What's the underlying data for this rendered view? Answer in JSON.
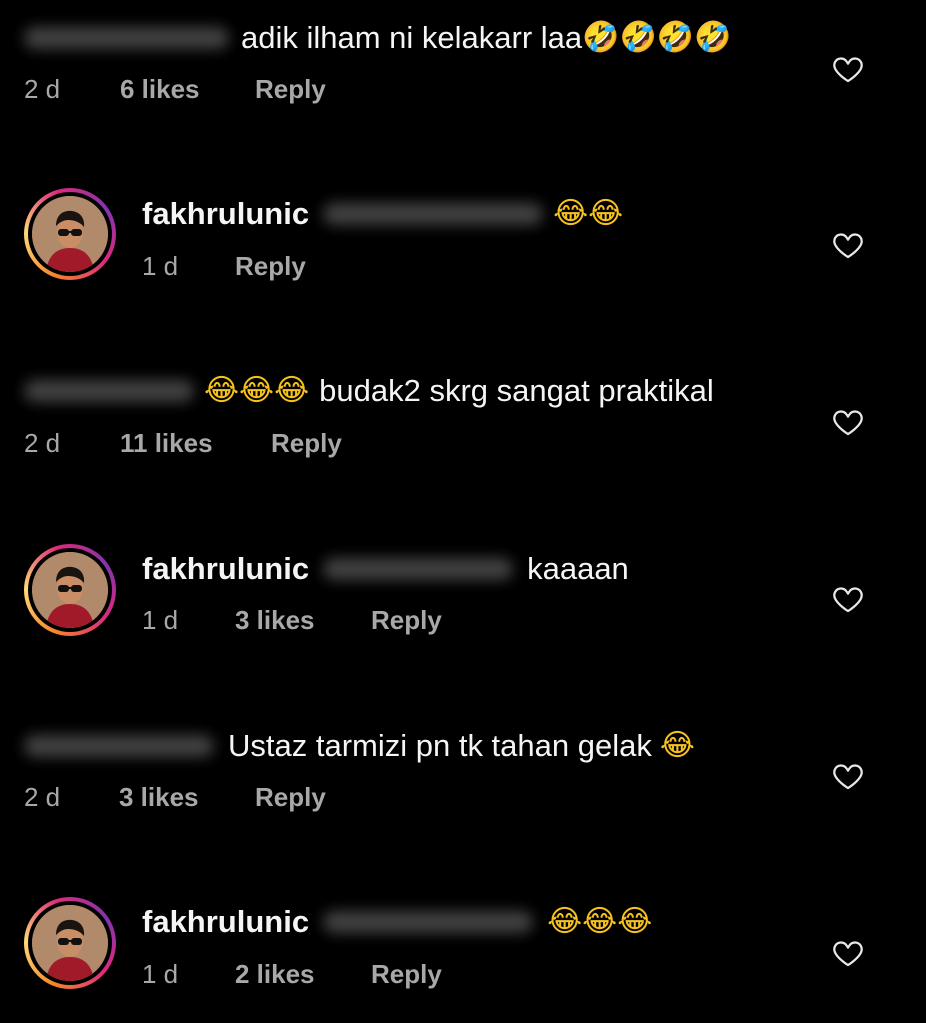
{
  "comments": [
    {
      "text": "adik ilham ni kelakarr laa",
      "emoji": "🤣🤣🤣🤣",
      "time": "2 d",
      "likes": "6 likes",
      "reply": "Reply"
    },
    {
      "username": "fakhrulunic",
      "text": "",
      "emoji": "😂😂",
      "time": "1 d",
      "likes": "",
      "reply": "Reply"
    },
    {
      "text": "budak2 skrg sangat praktikal",
      "emoji": "😂😂😂",
      "time": "2 d",
      "likes": "11 likes",
      "reply": "Reply"
    },
    {
      "username": "fakhrulunic",
      "text": "kaaaan",
      "emoji": "",
      "time": "1 d",
      "likes": "3 likes",
      "reply": "Reply"
    },
    {
      "text": "Ustaz tarmizi pn tk tahan gelak",
      "emoji": "😂",
      "time": "2 d",
      "likes": "3 likes",
      "reply": "Reply"
    },
    {
      "username": "fakhrulunic",
      "text": "",
      "emoji": "😂😂😂",
      "time": "1 d",
      "likes": "2 likes",
      "reply": "Reply"
    }
  ],
  "icons": {
    "like": "heart-outline-icon",
    "avatar": "profile-photo"
  },
  "colors": {
    "background": "#000000",
    "text": "#f5f5f5",
    "meta": "#a8a8a8",
    "story_ring": [
      "#f58529",
      "#dd2a7b",
      "#8134af"
    ]
  }
}
